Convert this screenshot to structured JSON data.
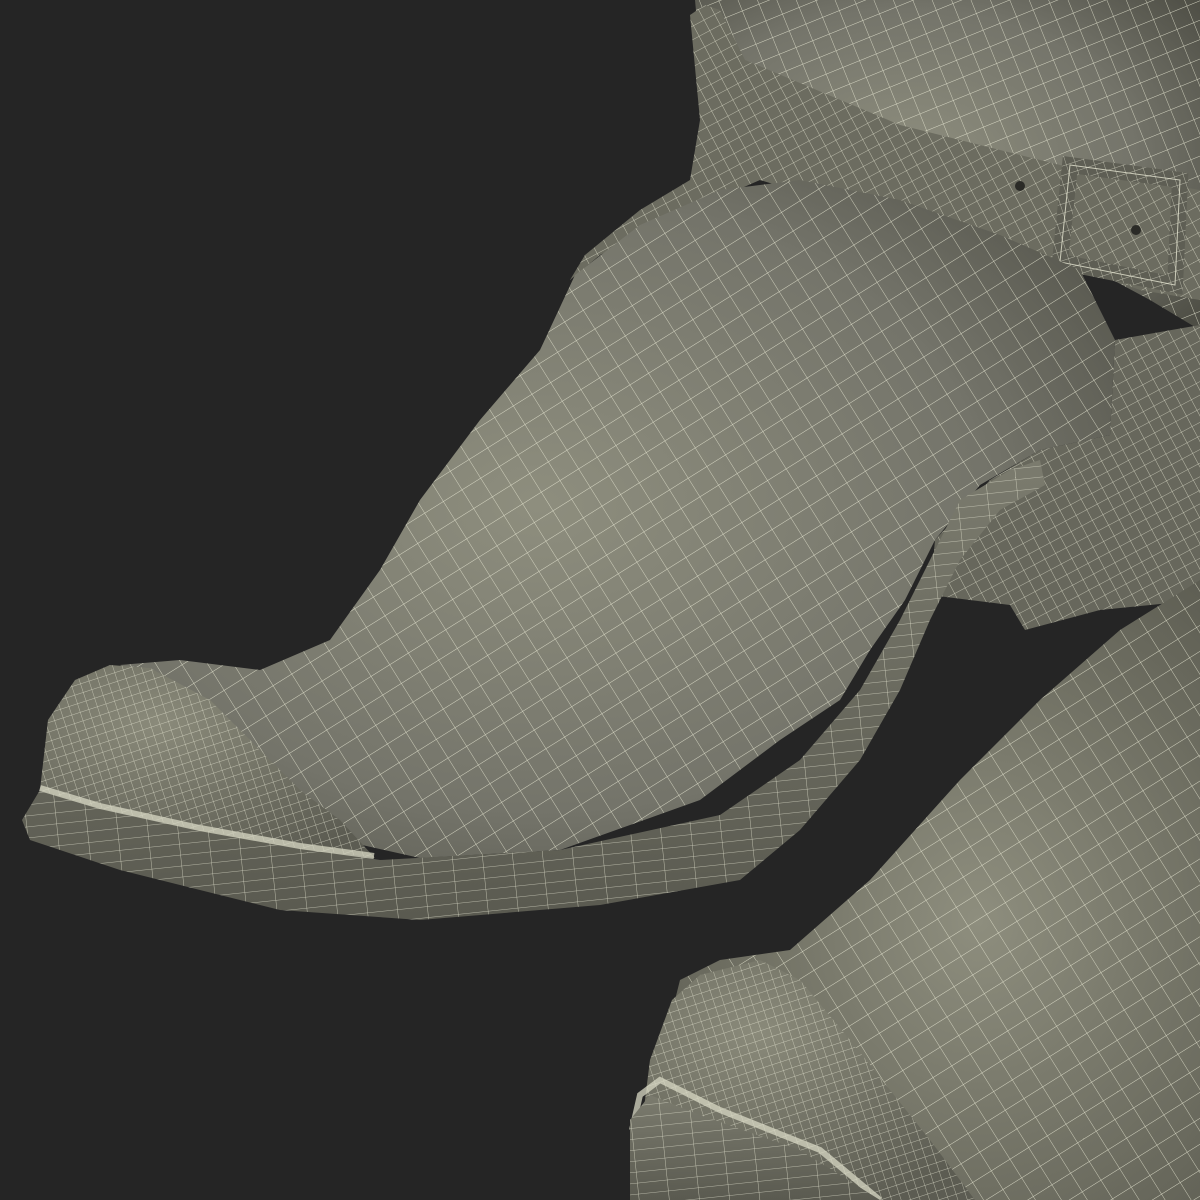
{
  "scene": {
    "subject": "wireframe-render",
    "colors": {
      "background": "#252525",
      "surface_light": "#8c8c7c",
      "surface_mid": "#6f6f62",
      "surface_dark": "#4a4a41",
      "wire": "#e6e6d2",
      "buckle": "#77776b"
    }
  }
}
